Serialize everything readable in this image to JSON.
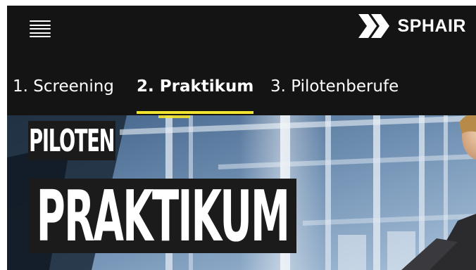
{
  "header": {
    "menu_icon": "hamburger-menu-icon",
    "brand_logo_icon": "double-chevron-logo-icon",
    "brand_name": "SPHAIR"
  },
  "tabs": [
    {
      "label": "1. Screening",
      "active": false
    },
    {
      "label": "2. Praktikum",
      "active": true
    },
    {
      "label": "3. Pilotenberufe",
      "active": false
    }
  ],
  "hero": {
    "kicker": "PILOTEN",
    "title": "PRAKTIKUM"
  },
  "colors": {
    "background": "#141414",
    "accent": "#f2e32e",
    "text": "#ffffff"
  }
}
